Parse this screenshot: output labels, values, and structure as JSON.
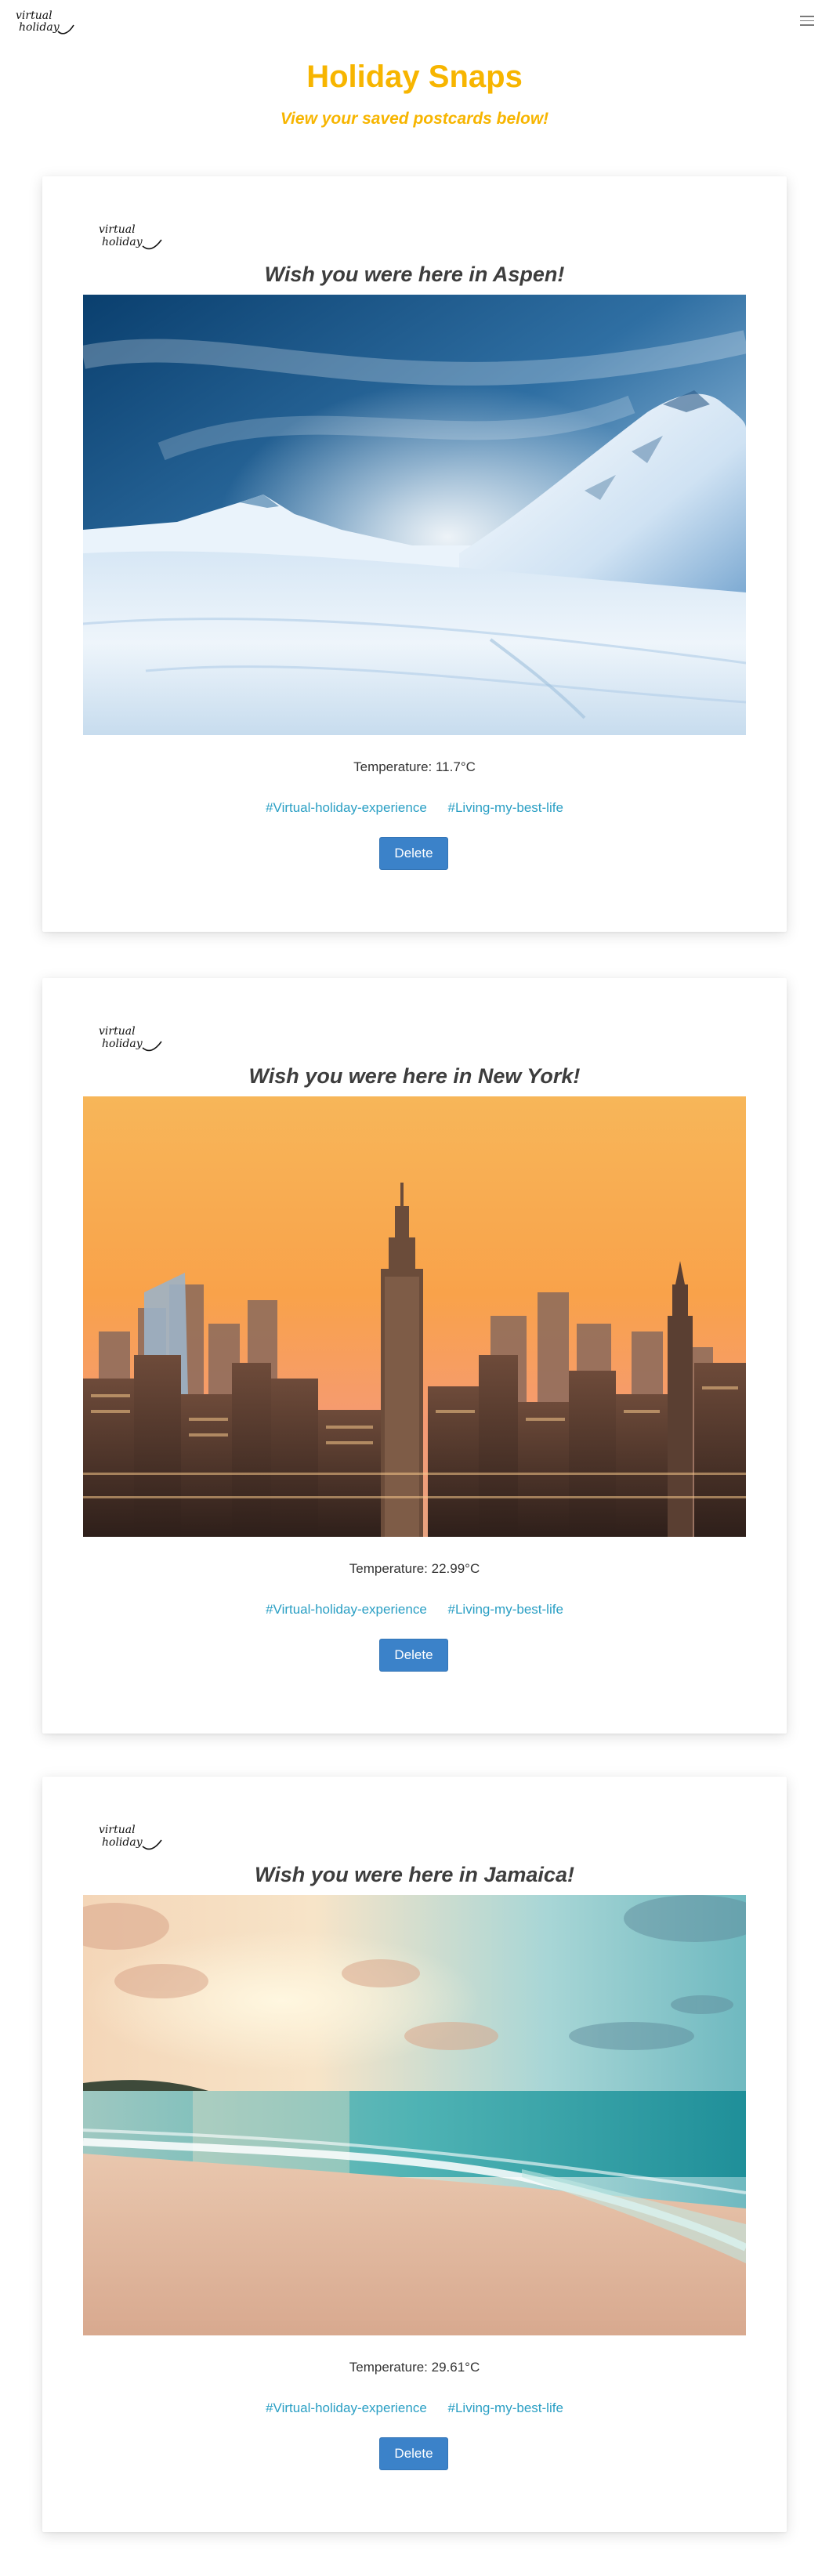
{
  "nav": {
    "logo_text_top": "virtual",
    "logo_text_bottom": "holiday",
    "menu_icon": "hamburger-icon"
  },
  "header": {
    "title": "Holiday Snaps",
    "subtitle": "View your saved postcards below!"
  },
  "colors": {
    "title": "#f7b500",
    "tag_link": "#2a9fc4",
    "delete_button": "#3b82c9"
  },
  "postcards": [
    {
      "title": "Wish you were here in Aspen!",
      "temperature_label": "Temperature: 11.7°C",
      "photo": "snowy-mountains-photo",
      "tags": [
        "#Virtual-holiday-experience",
        "#Living-my-best-life"
      ],
      "delete_label": "Delete"
    },
    {
      "title": "Wish you were here in New York!",
      "temperature_label": "Temperature: 22.99°C",
      "photo": "new-york-skyline-photo",
      "tags": [
        "#Virtual-holiday-experience",
        "#Living-my-best-life"
      ],
      "delete_label": "Delete"
    },
    {
      "title": "Wish you were here in Jamaica!",
      "temperature_label": "Temperature: 29.61°C",
      "photo": "tropical-beach-sunset-photo",
      "tags": [
        "#Virtual-holiday-experience",
        "#Living-my-best-life"
      ],
      "delete_label": "Delete"
    }
  ]
}
